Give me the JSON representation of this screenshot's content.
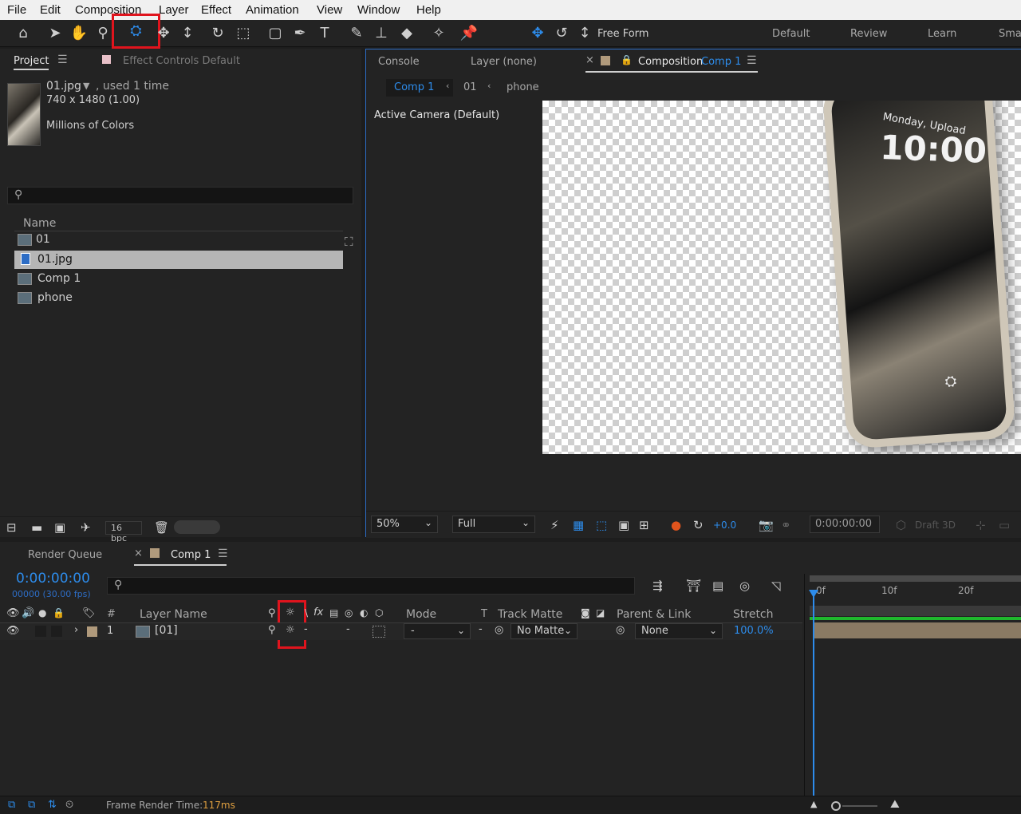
{
  "menu": {
    "file": "File",
    "edit": "Edit",
    "composition": "Composition",
    "layer": "Layer",
    "effect": "Effect",
    "animation": "Animation",
    "view": "View",
    "window": "Window",
    "help": "Help"
  },
  "toolbar": {
    "free_form": "Free Form",
    "workspaces": [
      "Default",
      "Review",
      "Learn",
      "Smal"
    ]
  },
  "project": {
    "tab": "Project",
    "effect_controls": "Effect Controls Default",
    "item_name": "01.jpg",
    "item_used": ", used 1 time",
    "item_size": "740 x 1480 (1.00)",
    "item_colors": "Millions of Colors",
    "column_name": "Name",
    "items": [
      "01",
      "01.jpg",
      "Comp 1",
      "phone"
    ],
    "bpc": "16 bpc"
  },
  "viewer": {
    "console": "Console",
    "layer_tab": "Layer (none)",
    "comp_tab_label": "Composition",
    "comp_tab_name": "Comp 1",
    "breadcrumbs": [
      "Comp 1",
      "01",
      "phone"
    ],
    "camera": "Active Camera (Default)",
    "phone_date": "Monday, Upload",
    "phone_time": "10:00",
    "zoom": "50%",
    "resolution": "Full",
    "exposure": "+0.0",
    "timecode": "0:00:00:00",
    "draft3d": "Draft 3D"
  },
  "timeline": {
    "render_queue": "Render Queue",
    "comp_tab": "Comp 1",
    "timecode": "0:00:00:00",
    "frames": "00000 (30.00 fps)",
    "col_hash": "#",
    "col_layer_name": "Layer Name",
    "col_mode": "Mode",
    "col_t": "T",
    "col_track_matte": "Track Matte",
    "col_parent": "Parent & Link",
    "col_stretch": "Stretch",
    "layer_num": "1",
    "layer_name": "[01]",
    "layer_mode": "-",
    "layer_matte": "No Matte",
    "layer_parent": "None",
    "layer_stretch": "100.0%",
    "ruler": [
      "0f",
      "10f",
      "20f"
    ]
  },
  "status": {
    "label": "Frame Render Time:",
    "value": "117ms"
  },
  "colors": {
    "accent": "#2d8ceb",
    "highlight": "#e0141d",
    "label_tan": "#b09a7c"
  }
}
